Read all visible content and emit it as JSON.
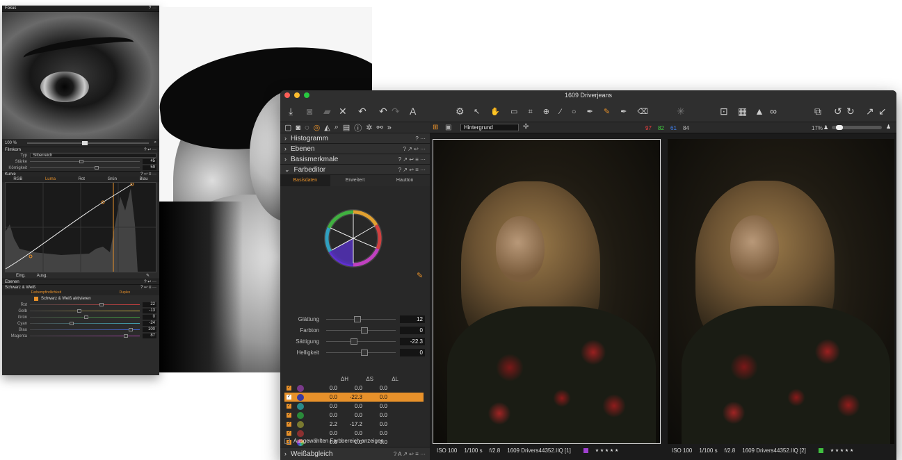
{
  "back_panel": {
    "header_title": "Fokus",
    "header_tools": "? ···",
    "zoom_label": "100 %",
    "filmkorn": {
      "title": "Filmkorn",
      "tools": "? ↩ ···",
      "type_label": "Typ",
      "type_value": "Silberreich",
      "staerke_label": "Stärke",
      "staerke_value": "45",
      "koernigkeit_label": "Körnigkeit",
      "koernigkeit_value": "59"
    },
    "kurve": {
      "title": "Kurve",
      "tools": "? ↩ ≡ ···",
      "tabs": [
        "RGB",
        "Luma",
        "Rot",
        "Grün",
        "Blau"
      ],
      "eing_label": "Eing.",
      "ausg_label": "Ausg."
    },
    "ebenen": {
      "title": "Ebenen",
      "tools": "? ↩ ···"
    },
    "sw": {
      "title": "Schwarz & Weiß",
      "tools": "? ↩ ≡ ···",
      "tab_left": "Farbempfindlichkeit",
      "tab_right": "Duplex",
      "activate_label": "Schwarz & Weiß aktivieren",
      "rows": [
        {
          "label": "Rot",
          "value": "22",
          "color": "#d14040"
        },
        {
          "label": "Gelb",
          "value": "-13",
          "color": "#c8b040"
        },
        {
          "label": "Grün",
          "value": "0",
          "color": "#40a040"
        },
        {
          "label": "Cyan",
          "value": "-24",
          "color": "#40a0b0"
        },
        {
          "label": "Blau",
          "value": "100",
          "color": "#4060d0"
        },
        {
          "label": "Magenta",
          "value": "87",
          "color": "#b040b0"
        }
      ]
    }
  },
  "window": {
    "title": "1609 Driverjeans",
    "sections": {
      "histogramm": {
        "label": "Histogramm",
        "tools": "? ···"
      },
      "ebenen": {
        "label": "Ebenen",
        "tools": "? ↗ ↩ ···"
      },
      "basismerkmale": {
        "label": "Basismerkmale",
        "tools": "? ↗ ↩ ≡ ···"
      },
      "farbeditor": {
        "label": "Farbeditor",
        "tools": "? ↗ ↩ ≡ ···"
      },
      "weissabgleich": {
        "label": "Weißabgleich",
        "tools": "? A ↗ ↩ ≡ ···"
      }
    },
    "color_tabs": [
      "Basisdaten",
      "Erweitert",
      "Hautton"
    ],
    "sliders": [
      {
        "label": "Glättung",
        "value": "12"
      },
      {
        "label": "Farbton",
        "value": "0"
      },
      {
        "label": "Sättigung",
        "value": "-22.3"
      },
      {
        "label": "Helligkeit",
        "value": "0"
      }
    ],
    "table_headers": [
      "ΔH",
      "ΔS",
      "ΔL"
    ],
    "table_rows": [
      {
        "color": "#7a3a8a",
        "h": "0.0",
        "s": "0.0",
        "l": "0.0"
      },
      {
        "color": "#3a3aa0",
        "h": "0.0",
        "s": "-22.3",
        "l": "0.0"
      },
      {
        "color": "#2a8a8a",
        "h": "0.0",
        "s": "0.0",
        "l": "0.0"
      },
      {
        "color": "#2a8a3a",
        "h": "0.0",
        "s": "0.0",
        "l": "0.0"
      },
      {
        "color": "#7a7a30",
        "h": "2.2",
        "s": "-17.2",
        "l": "0.0"
      },
      {
        "color": "#8a3030",
        "h": "0.0",
        "s": "0.0",
        "l": "0.0"
      },
      {
        "color": "#cccccc",
        "h": "0.0",
        "s": "0.0",
        "l": "0.0"
      }
    ],
    "show_range_label": "Ausgewählten Farbbereich anzeigen",
    "swatch_before": "#6a48b0",
    "swatch_after": "#6a52a8",
    "layer_select": "Hintergrund",
    "rgb": {
      "r": "97",
      "g": "82",
      "b": "61",
      "l": "84"
    },
    "zoom": "17%",
    "left_photo": {
      "iso": "ISO 100",
      "shutter": "1/100 s",
      "aperture": "f/2.8",
      "file": "1609 Drivers44352.IIQ [1]",
      "stars": "★ ★ ★ ★ ★",
      "tag_color": "#a040d0"
    },
    "right_photo": {
      "iso": "ISO 100",
      "shutter": "1/100 s",
      "aperture": "f/2.8",
      "file": "1609 Drivers44352.IIQ [2]",
      "stars": "★ ★ ★ ★ ★",
      "tag_color": "#40c040"
    }
  }
}
